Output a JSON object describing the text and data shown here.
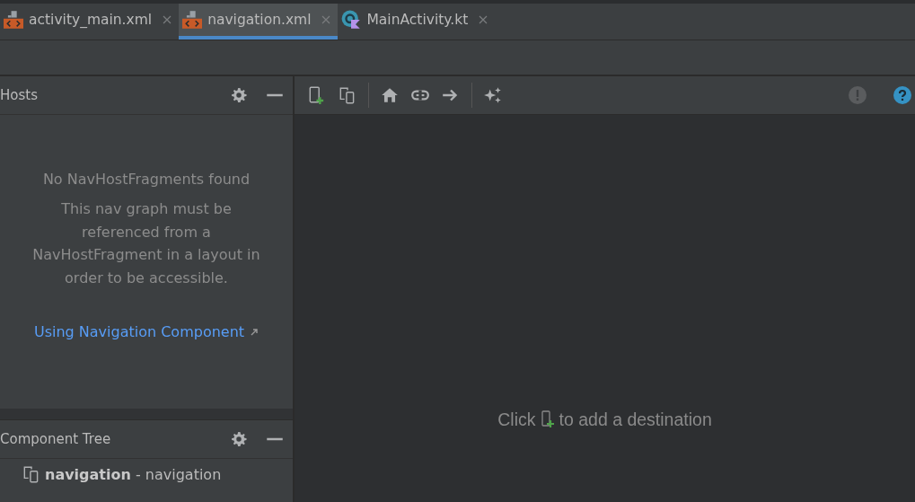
{
  "tabs": [
    {
      "label": "activity_main.xml",
      "kind": "xml",
      "selected": false
    },
    {
      "label": "navigation.xml",
      "kind": "xml",
      "selected": true
    },
    {
      "label": "MainActivity.kt",
      "kind": "kotlin",
      "selected": false
    }
  ],
  "hosts_panel": {
    "title": "Hosts",
    "message_title": "No NavHostFragments found",
    "message": "This nav graph must be referenced from a NavHostFragment in a layout in order to be accessible.",
    "link": "Using Navigation Component"
  },
  "component_tree": {
    "title": "Component Tree",
    "items": [
      {
        "label": "**navigation** - navigation"
      }
    ]
  },
  "canvas": {
    "hint_before": "Click",
    "hint_after": "to add a destination"
  }
}
